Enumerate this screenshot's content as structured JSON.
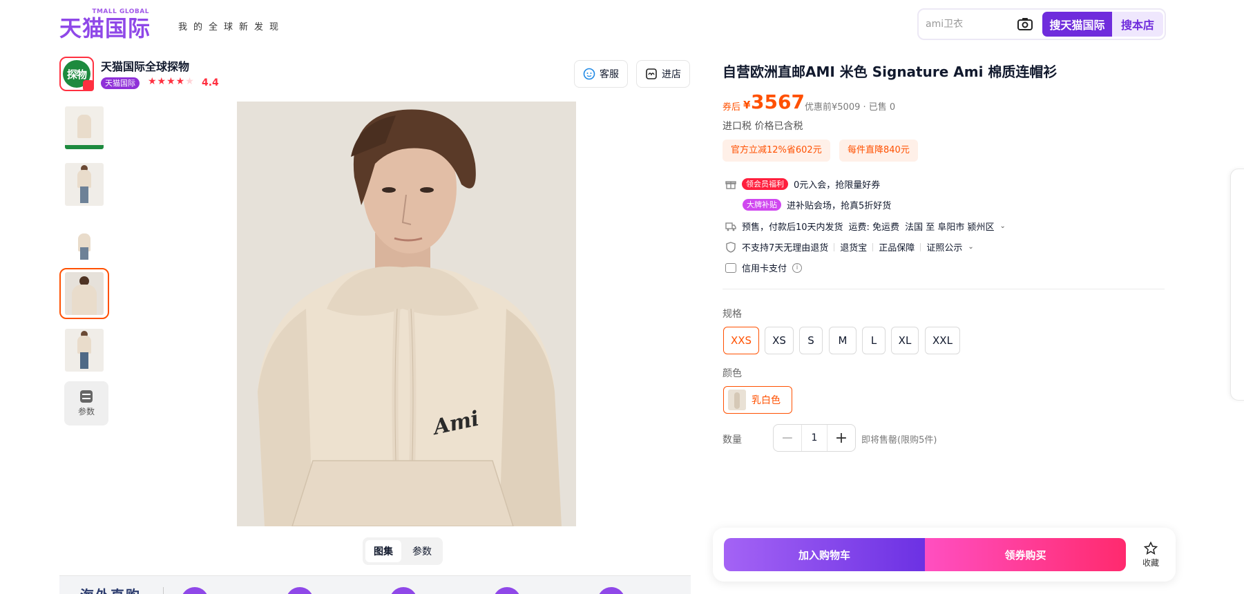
{
  "header": {
    "logo_sub": "TMALL GLOBAL",
    "logo_main": "天猫国际",
    "slogan": "我的全球新发现",
    "search_placeholder": "ami卫衣",
    "search_tmall_label": "搜天猫国际",
    "search_store_label": "搜本店"
  },
  "shop": {
    "avatar_text": "探物",
    "name": "天猫国际全球探物",
    "badge": "天猫国际",
    "rating": "4.4",
    "service_label": "客服",
    "enter_shop_label": "进店"
  },
  "thumbnails": {
    "params_label": "参数",
    "active_index": 3
  },
  "view_tabs": [
    "图集",
    "参数"
  ],
  "bottom_strip": {
    "label": "海外直购"
  },
  "product": {
    "title": "自营欧洲直邮AMI 米色 Signature Ami 棉质连帽衫",
    "price_label": "券后",
    "currency": "¥",
    "price": "3567",
    "original": "优惠前¥5009 · 已售 0",
    "tax": "进口税 价格已含税",
    "promos": [
      "官方立减12%省602元",
      "每件直降840元"
    ]
  },
  "services": {
    "member_tag": "领会员福利",
    "member_text": "0元入会，抢限量好券",
    "brand_tag": "大牌补贴",
    "brand_text": "进补贴会场，抢真5折好货",
    "shipping": "预售，付款后10天内发货",
    "freight": "运费: 免运费",
    "route": "法国 至 阜阳市 颍州区",
    "return_policy": "不支持7天无理由退货",
    "return_insurance": "退货宝",
    "authentic": "正品保障",
    "license": "证照公示",
    "payment": "信用卡支付"
  },
  "spec": {
    "size_label": "规格",
    "sizes": [
      "XXS",
      "XS",
      "S",
      "M",
      "L",
      "XL",
      "XXL"
    ],
    "selected_size": "XXS",
    "color_label": "颜色",
    "color": "乳白色",
    "quantity_label": "数量",
    "quantity": "1",
    "quantity_note": "即将售罄(限购5件)"
  },
  "actions": {
    "add_to_cart": "加入购物车",
    "buy_with_coupon": "领券购买",
    "favorite": "收藏"
  },
  "colors": {
    "brand_purple": "#6f2cdc",
    "price_orange": "#ff5000",
    "rating_red": "#ff3040"
  }
}
